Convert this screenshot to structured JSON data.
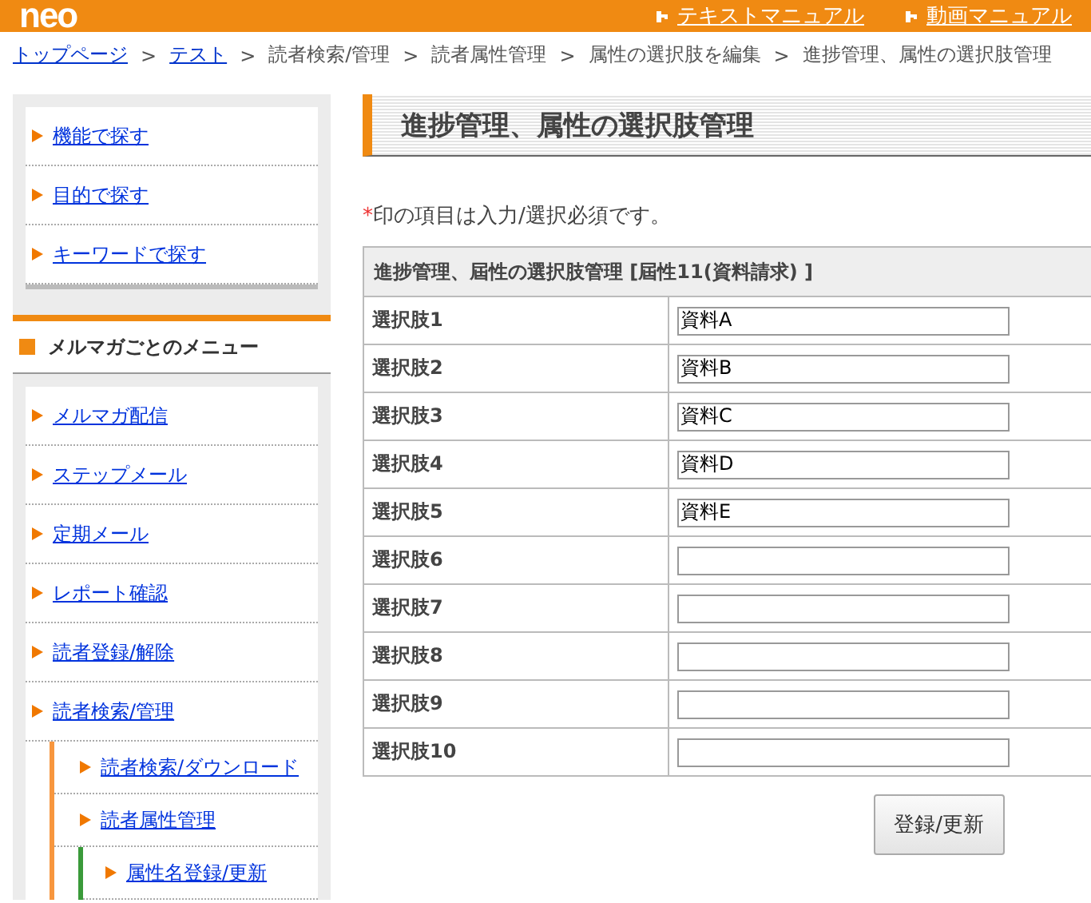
{
  "header": {
    "logo": "neo",
    "links": [
      {
        "label": "テキストマニュアル"
      },
      {
        "label": "動画マニュアル"
      }
    ]
  },
  "breadcrumb": [
    {
      "label": "トップページ",
      "link": true
    },
    {
      "label": "テスト",
      "link": true
    },
    {
      "label": "読者検索/管理",
      "link": false
    },
    {
      "label": "読者属性管理",
      "link": false
    },
    {
      "label": "属性の選択肢を編集",
      "link": false
    },
    {
      "label": "進捗管理、属性の選択肢管理",
      "link": false
    }
  ],
  "breadcrumb_separator": ">",
  "sidebar": {
    "search_links": [
      {
        "label": "機能で探す"
      },
      {
        "label": "目的で探す"
      },
      {
        "label": "キーワードで探す"
      }
    ],
    "menu_title": "メルマガごとのメニュー",
    "menu": [
      {
        "label": "メルマガ配信"
      },
      {
        "label": "ステップメール"
      },
      {
        "label": "定期メール"
      },
      {
        "label": "レポート確認"
      },
      {
        "label": "読者登録/解除"
      },
      {
        "label": "読者検索/管理",
        "children": [
          {
            "label": "読者検索/ダウンロード"
          },
          {
            "label": "読者属性管理",
            "children": [
              {
                "label": "属性名登録/更新"
              }
            ]
          }
        ]
      }
    ]
  },
  "main": {
    "title": "進捗管理、属性の選択肢管理",
    "required_mark": "*",
    "note": "印の項目は入力/選択必須です。",
    "table": {
      "caption": "進捗管理、屆性の選択肢管理 [屆性11(資料請求) ]",
      "rows": [
        {
          "label": "選択肢1",
          "value": "資料A"
        },
        {
          "label": "選択肢2",
          "value": "資料B"
        },
        {
          "label": "選択肢3",
          "value": "資料C"
        },
        {
          "label": "選択肢4",
          "value": "資料D"
        },
        {
          "label": "選択肢5",
          "value": "資料E"
        },
        {
          "label": "選択肢6"
        },
        {
          "label": "選択肢7"
        },
        {
          "label": "選択肢8"
        },
        {
          "label": "選択肢9"
        },
        {
          "label": "選択肢10"
        }
      ]
    },
    "submit": "登録/更新"
  }
}
